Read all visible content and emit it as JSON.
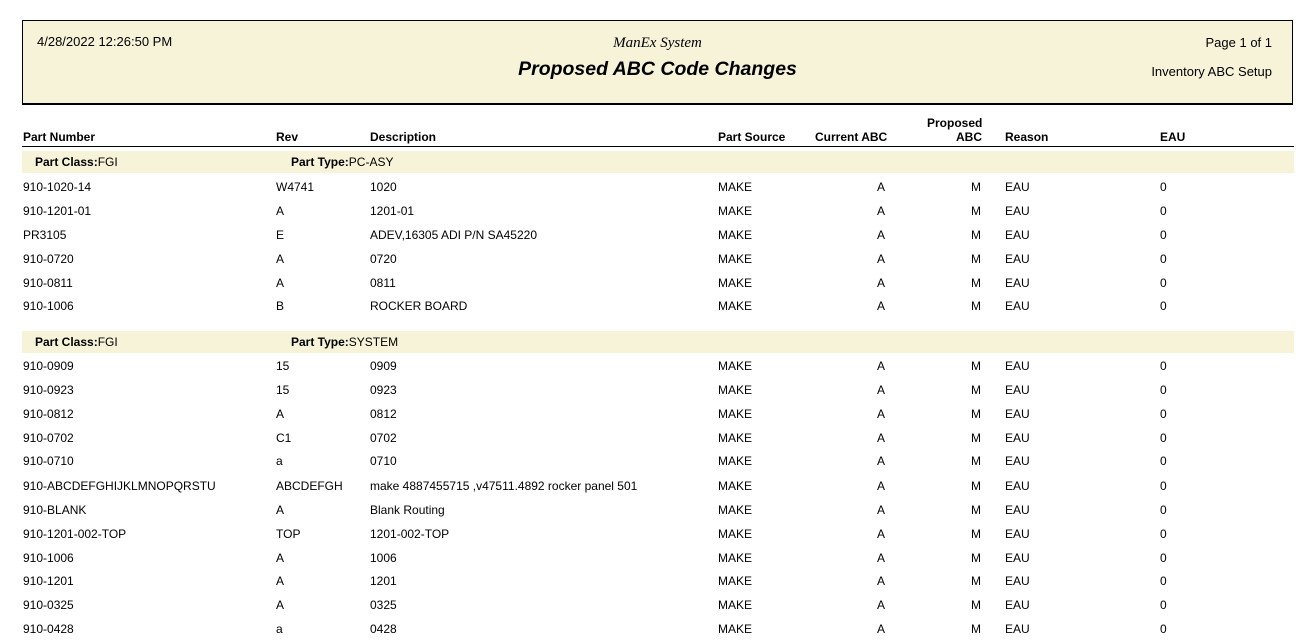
{
  "header": {
    "datetime": "4/28/2022 12:26:50 PM",
    "system": "ManEx System",
    "title": "Proposed ABC Code Changes",
    "page": "Page 1 of 1",
    "subtitle": "Inventory ABC Setup"
  },
  "columns": {
    "part_number": "Part Number",
    "rev": "Rev",
    "description": "Description",
    "part_source": "Part Source",
    "current_abc": "Current ABC",
    "proposed_line1": "Proposed",
    "proposed_line2": "ABC",
    "reason": "Reason",
    "eau": "EAU"
  },
  "groups": [
    {
      "class_label": "Part Class:",
      "class_value": "FGI",
      "type_label": "Part Type:",
      "type_value": "PC-ASY",
      "rows": [
        [
          "910-1020-14",
          "W4741",
          "1020",
          "MAKE",
          "A",
          "M",
          "EAU",
          "0"
        ],
        [
          "910-1201-01",
          "A",
          "1201-01",
          "MAKE",
          "A",
          "M",
          "EAU",
          "0"
        ],
        [
          "PR3105",
          "E",
          "ADEV,16305 ADI P/N SA45220",
          "MAKE",
          "A",
          "M",
          "EAU",
          "0"
        ],
        [
          "910-0720",
          "A",
          "0720",
          "MAKE",
          "A",
          "M",
          "EAU",
          "0"
        ],
        [
          "910-0811",
          "A",
          "0811",
          "MAKE",
          "A",
          "M",
          "EAU",
          "0"
        ],
        [
          "910-1006",
          "B",
          "ROCKER BOARD",
          "MAKE",
          "A",
          "M",
          "EAU",
          "0"
        ]
      ]
    },
    {
      "class_label": "Part Class:",
      "class_value": "FGI",
      "type_label": "Part Type:",
      "type_value": "SYSTEM",
      "rows": [
        [
          "910-0909",
          "15",
          "0909",
          "MAKE",
          "A",
          "M",
          "EAU",
          "0"
        ],
        [
          "910-0923",
          "15",
          "0923",
          "MAKE",
          "A",
          "M",
          "EAU",
          "0"
        ],
        [
          "910-0812",
          "A",
          "0812",
          "MAKE",
          "A",
          "M",
          "EAU",
          "0"
        ],
        [
          "910-0702",
          "C1",
          "0702",
          "MAKE",
          "A",
          "M",
          "EAU",
          "0"
        ],
        [
          "910-0710",
          "a",
          "0710",
          "MAKE",
          "A",
          "M",
          "EAU",
          "0"
        ],
        [
          "910-ABCDEFGHIJKLMNOPQRSTU",
          "ABCDEFGH",
          "make 4887455715 ,v47511.4892 rocker panel 501",
          "MAKE",
          "A",
          "M",
          "EAU",
          "0"
        ],
        [
          "910-BLANK",
          "A",
          "Blank Routing",
          "MAKE",
          "A",
          "M",
          "EAU",
          "0"
        ],
        [
          "910-1201-002-TOP",
          "TOP",
          "1201-002-TOP",
          "MAKE",
          "A",
          "M",
          "EAU",
          "0"
        ],
        [
          "910-1006",
          "A",
          "1006",
          "MAKE",
          "A",
          "M",
          "EAU",
          "0"
        ],
        [
          "910-1201",
          "A",
          "1201",
          "MAKE",
          "A",
          "M",
          "EAU",
          "0"
        ],
        [
          "910-0325",
          "A",
          "0325",
          "MAKE",
          "A",
          "M",
          "EAU",
          "0"
        ],
        [
          "910-0428",
          "a",
          "0428",
          "MAKE",
          "A",
          "M",
          "EAU",
          "0"
        ]
      ]
    }
  ]
}
